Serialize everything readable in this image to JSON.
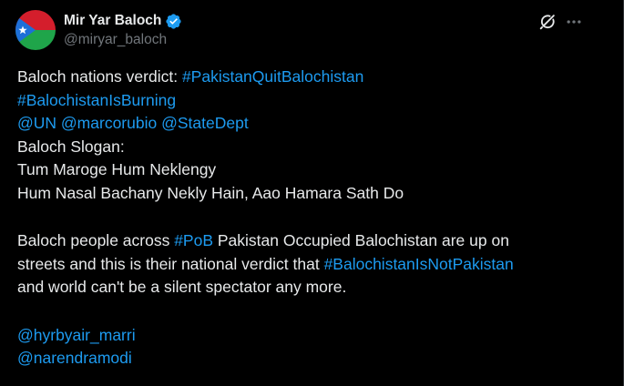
{
  "author": {
    "display_name": "Mir Yar Baloch",
    "handle": "@miryar_baloch",
    "verified": true,
    "avatar_colors": {
      "top": "#d41e2c",
      "bottom": "#1fa54a",
      "triangle": "#1d6fd8",
      "star": "#ffffff"
    }
  },
  "header_icons": {
    "grok": "grok-icon",
    "more": "more-icon"
  },
  "colors": {
    "background": "#000000",
    "text": "#e7e9ea",
    "muted": "#71767b",
    "link": "#1d9bf0",
    "verified_badge": "#1d9bf0"
  },
  "tweet": {
    "line1_text": "Baloch nations verdict: ",
    "hashtag_quit": "#PakistanQuitBalochistan",
    "hashtag_burning": "#BalochistanIsBurning",
    "mention_un": "@UN",
    "mention_rubio": "@marcorubio",
    "mention_statedept": "@StateDept",
    "slogan_heading": "Baloch Slogan:",
    "slogan_line1": "Tum Maroge Hum Neklengy",
    "slogan_line2": "Hum Nasal Bachany Nekly Hain, Aao Hamara Sath Do",
    "para2_before_pob": "Baloch people across ",
    "hashtag_pob": "#PoB",
    "para2_after_pob": " Pakistan Occupied Balochistan are up on",
    "para2_line2_text": "streets and this is their national verdict that ",
    "hashtag_notpakistan": "#BalochistanIsNotPakistan",
    "para2_line3": "and world can't be a silent spectator any more.",
    "mention_hyrbyair": "@hyrbyair_marri",
    "mention_modi": "@narendramodi"
  }
}
